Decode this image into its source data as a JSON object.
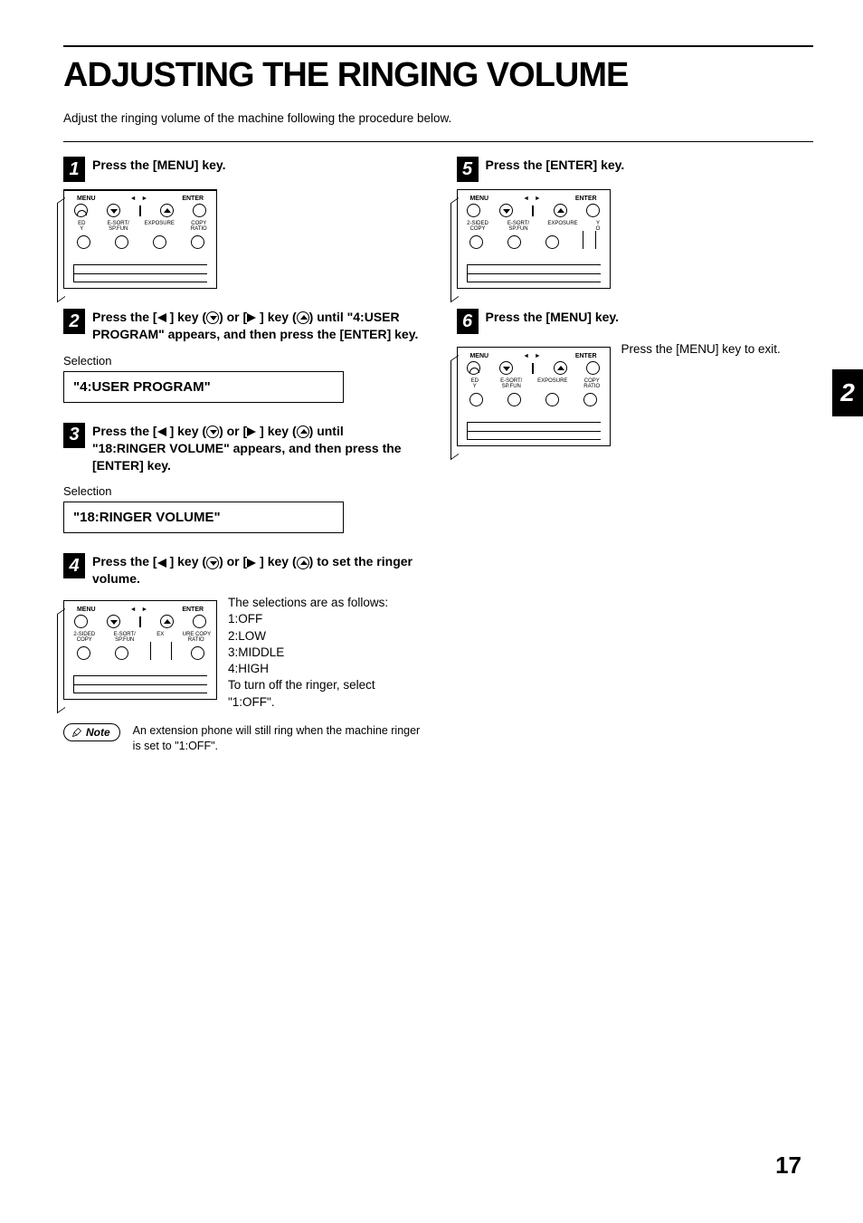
{
  "title": "ADJUSTING THE RINGING VOLUME",
  "intro": "Adjust the ringing volume of the machine following the procedure below.",
  "side_tab": "2",
  "page_number": "17",
  "keypad_labels": {
    "menu": "MENU",
    "enter": "ENTER",
    "l2a": "2-SIDED",
    "l2a2": "COPY",
    "l2a_alt": "ED",
    "l2a_alt2": "Y",
    "l2b": "E-SORT/",
    "l2b2": "SP.FUN",
    "l2c": "EXPOSURE",
    "l2c_alt": "EX",
    "l2c_alt2": "URE",
    "l2d": "COPY",
    "l2d2": "RATIO"
  },
  "steps": [
    {
      "num": "1",
      "title_parts": [
        "Press the [MENU] key."
      ]
    },
    {
      "num": "2",
      "title_parts": [
        "Press the [",
        "ARROW_L",
        "] key (",
        "CIRC_DN",
        ") or [",
        "ARROW_R",
        "] key (",
        "CIRC_UP",
        ") until \"4:USER PROGRAM\" appears, and then press the [ENTER] key."
      ],
      "selection_label": "Selection",
      "selection_value": "\"4:USER PROGRAM\""
    },
    {
      "num": "3",
      "title_parts": [
        "Press the [",
        "ARROW_L",
        "] key (",
        "CIRC_DN",
        ") or [",
        "ARROW_R",
        "] key (",
        "CIRC_UP",
        ") until \"18:RINGER VOLUME\" appears, and then press the [ENTER] key."
      ],
      "selection_label": "Selection",
      "selection_value": "\"18:RINGER VOLUME\""
    },
    {
      "num": "4",
      "title_parts": [
        "Press the [",
        "ARROW_L",
        "] key (",
        "CIRC_DN",
        ") or [",
        "ARROW_R",
        "] key (",
        "CIRC_UP",
        ") to set the ringer volume."
      ],
      "body_lines": [
        "The selections are as follows:",
        "1:OFF",
        "2:LOW",
        "3:MIDDLE",
        "4:HIGH",
        "To turn off the ringer, select \"1:OFF\"."
      ],
      "note_label": "Note",
      "note_text": "An extension phone will still ring when the machine ringer is set to \"1:OFF\"."
    },
    {
      "num": "5",
      "title_parts": [
        "Press the [ENTER] key."
      ]
    },
    {
      "num": "6",
      "title_parts": [
        "Press the [MENU] key."
      ],
      "side_text": "Press the [MENU] key to exit."
    }
  ]
}
